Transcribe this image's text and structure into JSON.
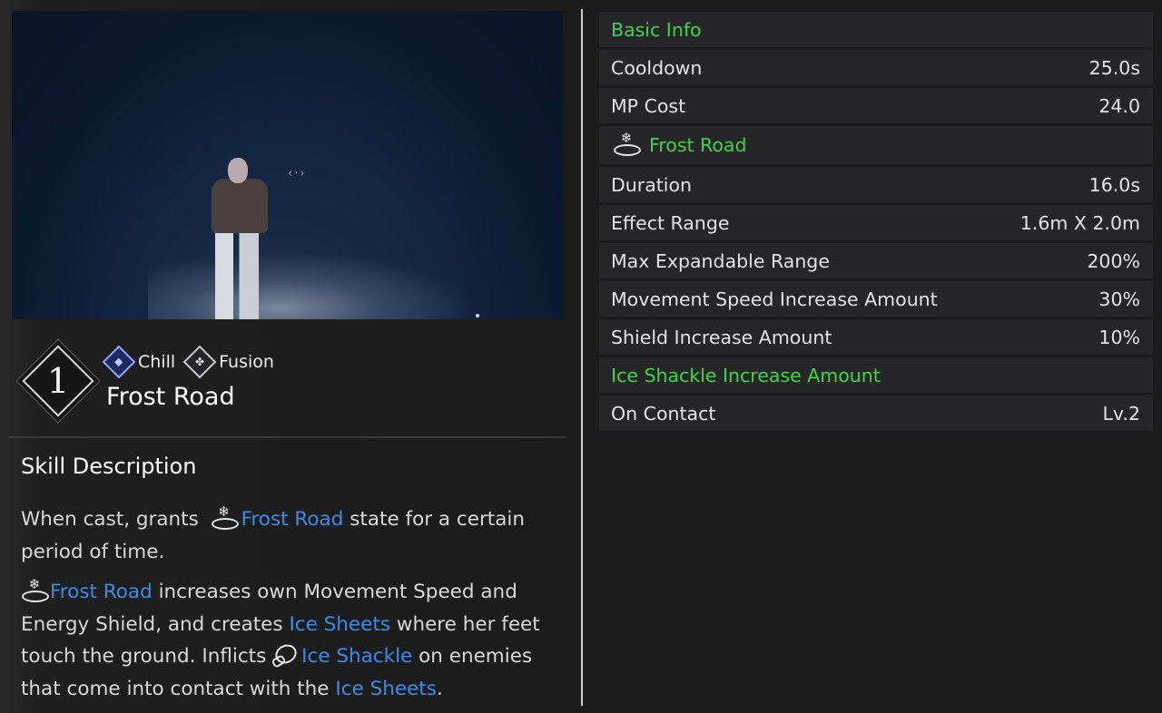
{
  "preview": {
    "move_hint": "‹·›"
  },
  "skill": {
    "slot_number": "1",
    "tags": [
      {
        "label": "Chill",
        "icon": "chill-diamond-icon",
        "color": "#8fa6ff"
      },
      {
        "label": "Fusion",
        "icon": "fusion-diamond-icon",
        "color": "#c9c9c9"
      }
    ],
    "title": "Frost Road"
  },
  "description": {
    "heading": "Skill Description",
    "p1": {
      "t1": "When cast, grants ",
      "hl1": "Frost Road",
      "t2": " state for a certain period of time."
    },
    "p2": {
      "hl1": "Frost Road",
      "t1": " increases own Movement Speed and Energy Shield, and creates ",
      "hl2": "Ice Sheets",
      "t2": " where her feet touch the ground. Inflicts ",
      "hl3": "Ice Shackle",
      "t3": " on enemies that come into contact with the ",
      "hl4": "Ice Sheets",
      "t4": "."
    },
    "highlight_color": "#3b8ce8"
  },
  "stats": {
    "section_color": "#3fd44a",
    "basic_info": {
      "title": "Basic Info",
      "cooldown_label": "Cooldown",
      "cooldown_value": "25.0s",
      "mp_label": "MP Cost",
      "mp_value": "24.0"
    },
    "frost_road": {
      "title": "Frost Road",
      "duration_label": "Duration",
      "duration_value": "16.0s",
      "range_label": "Effect Range",
      "range_value": "1.6m X 2.0m",
      "max_range_label": "Max Expandable Range",
      "max_range_value": "200%",
      "speed_label": "Movement Speed Increase Amount",
      "speed_value": "30%",
      "shield_label": "Shield Increase Amount",
      "shield_value": "10%"
    },
    "ice_shackle": {
      "title": "Ice Shackle Increase Amount",
      "contact_label": "On Contact",
      "contact_value": "Lv.2"
    }
  }
}
